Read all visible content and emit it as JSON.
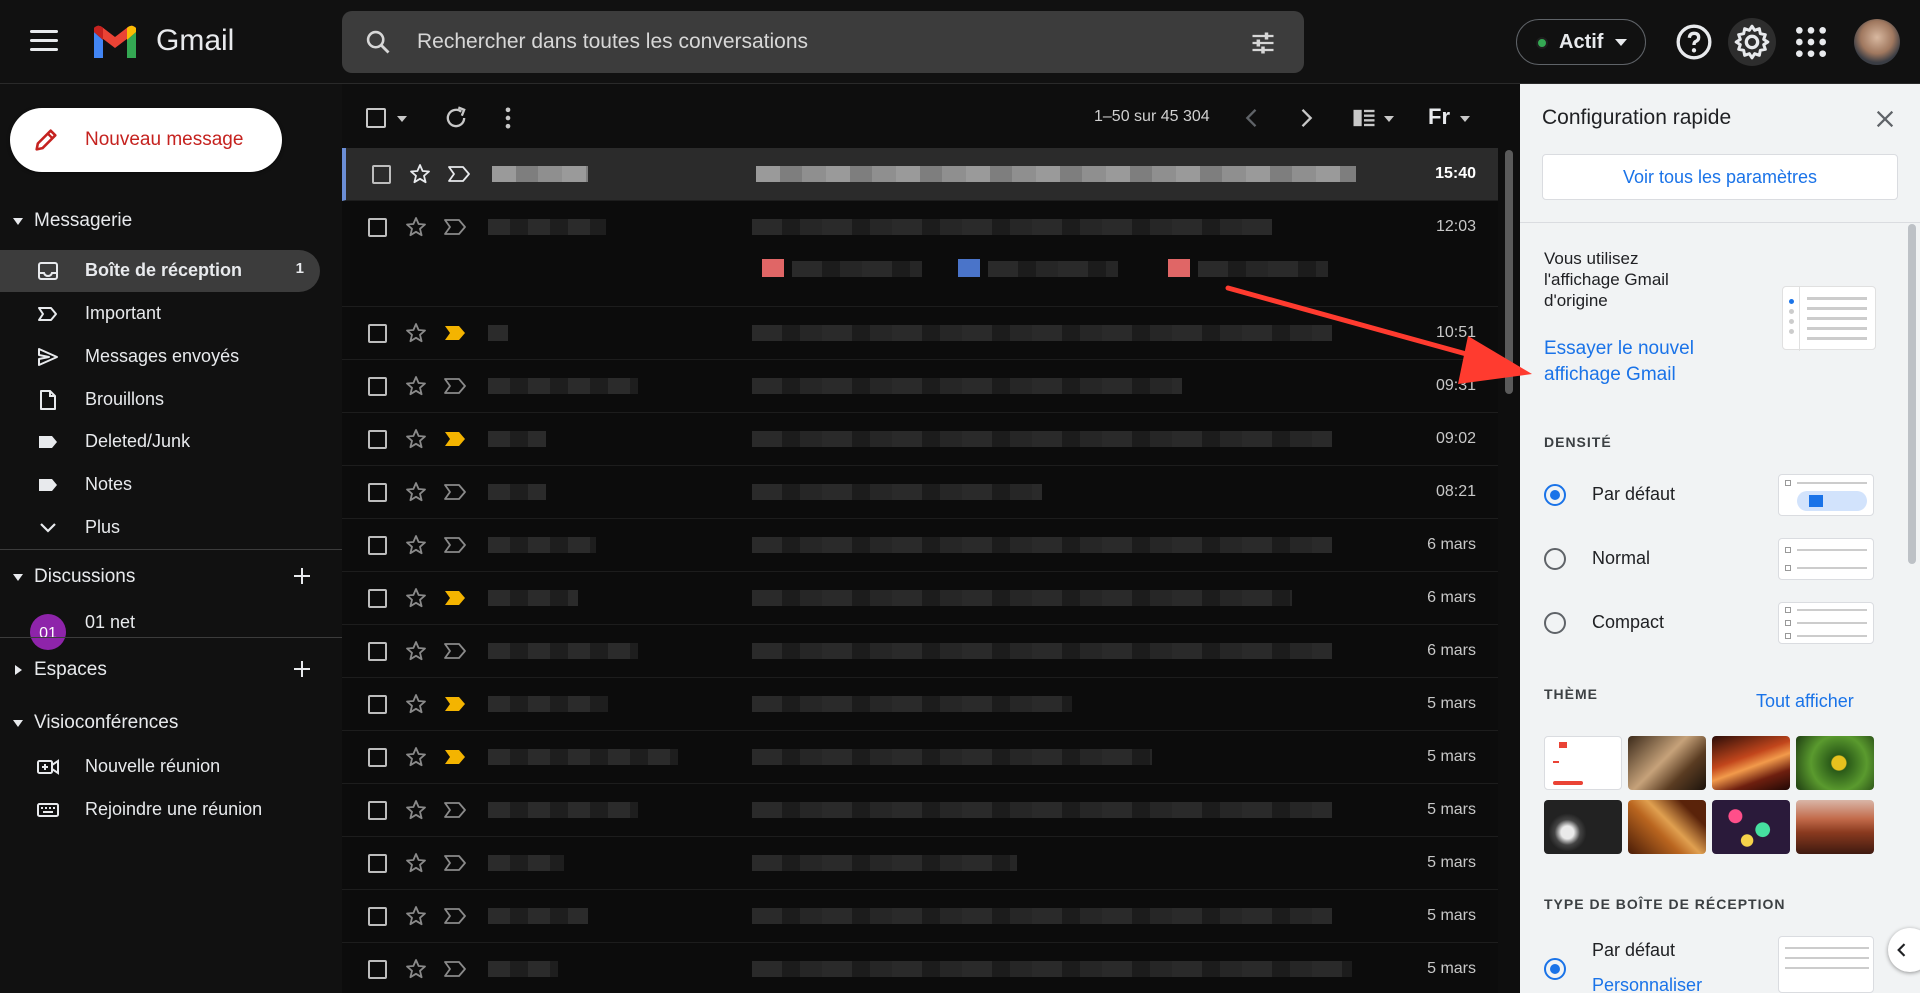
{
  "app": {
    "name": "Gmail"
  },
  "search": {
    "placeholder": "Rechercher dans toutes les conversations"
  },
  "status": {
    "label": "Actif",
    "color": "#34a853"
  },
  "compose": {
    "label": "Nouveau message"
  },
  "sidebar": {
    "mail_section": "Messagerie",
    "items": [
      {
        "label": "Boîte de réception",
        "count": "1",
        "icon": "inbox-icon"
      },
      {
        "label": "Important",
        "icon": "important-icon"
      },
      {
        "label": "Messages envoyés",
        "icon": "send-icon"
      },
      {
        "label": "Brouillons",
        "icon": "draft-icon"
      },
      {
        "label": "Deleted/Junk",
        "icon": "label-icon"
      },
      {
        "label": "Notes",
        "icon": "label-icon"
      },
      {
        "label": "Plus",
        "icon": "chevron-down-icon"
      }
    ],
    "chat_section": "Discussions",
    "chat_item": {
      "avatar_text": "01",
      "label": "01 net"
    },
    "spaces_section": "Espaces",
    "meet_section": "Visioconférences",
    "meet_items": [
      {
        "label": "Nouvelle réunion",
        "icon": "video-plus-icon"
      },
      {
        "label": "Rejoindre une réunion",
        "icon": "keyboard-icon"
      }
    ]
  },
  "toolbar": {
    "pager": "1–50 sur 45 304",
    "lang": "Fr"
  },
  "emails": [
    {
      "date": "15:40",
      "important": false,
      "unread": true
    },
    {
      "date": "12:03",
      "important": false
    },
    {
      "date": "10:51",
      "important": true
    },
    {
      "date": "09:31",
      "important": false
    },
    {
      "date": "09:02",
      "important": true
    },
    {
      "date": "08:21",
      "important": false
    },
    {
      "date": "6 mars",
      "important": false
    },
    {
      "date": "6 mars",
      "important": true
    },
    {
      "date": "6 mars",
      "important": false
    },
    {
      "date": "5 mars",
      "important": true
    },
    {
      "date": "5 mars",
      "important": true
    },
    {
      "date": "5 mars",
      "important": false
    },
    {
      "date": "5 mars",
      "important": false
    },
    {
      "date": "5 mars",
      "important": false
    },
    {
      "date": "5 mars",
      "important": false
    }
  ],
  "quick_settings": {
    "title": "Configuration rapide",
    "all_settings": "Voir tous les paramètres",
    "classic_line1": "Vous utilisez",
    "classic_line2": "l'affichage Gmail",
    "classic_line3": "d'origine",
    "try_new_line1": "Essayer le nouvel",
    "try_new_line2": "affichage Gmail",
    "density_header": "DENSITÉ",
    "density_options": [
      "Par défaut",
      "Normal",
      "Compact"
    ],
    "theme_header": "THÈME",
    "theme_show_all": "Tout afficher",
    "inbox_type_header": "TYPE DE BOÎTE DE RÉCEPTION",
    "inbox_type_option": "Par défaut",
    "customize": "Personnaliser"
  },
  "colors": {
    "accent": "#1a73e8",
    "important": "#f4b400",
    "compose_text": "#c5221f",
    "arrow": "#ff3b2f"
  }
}
